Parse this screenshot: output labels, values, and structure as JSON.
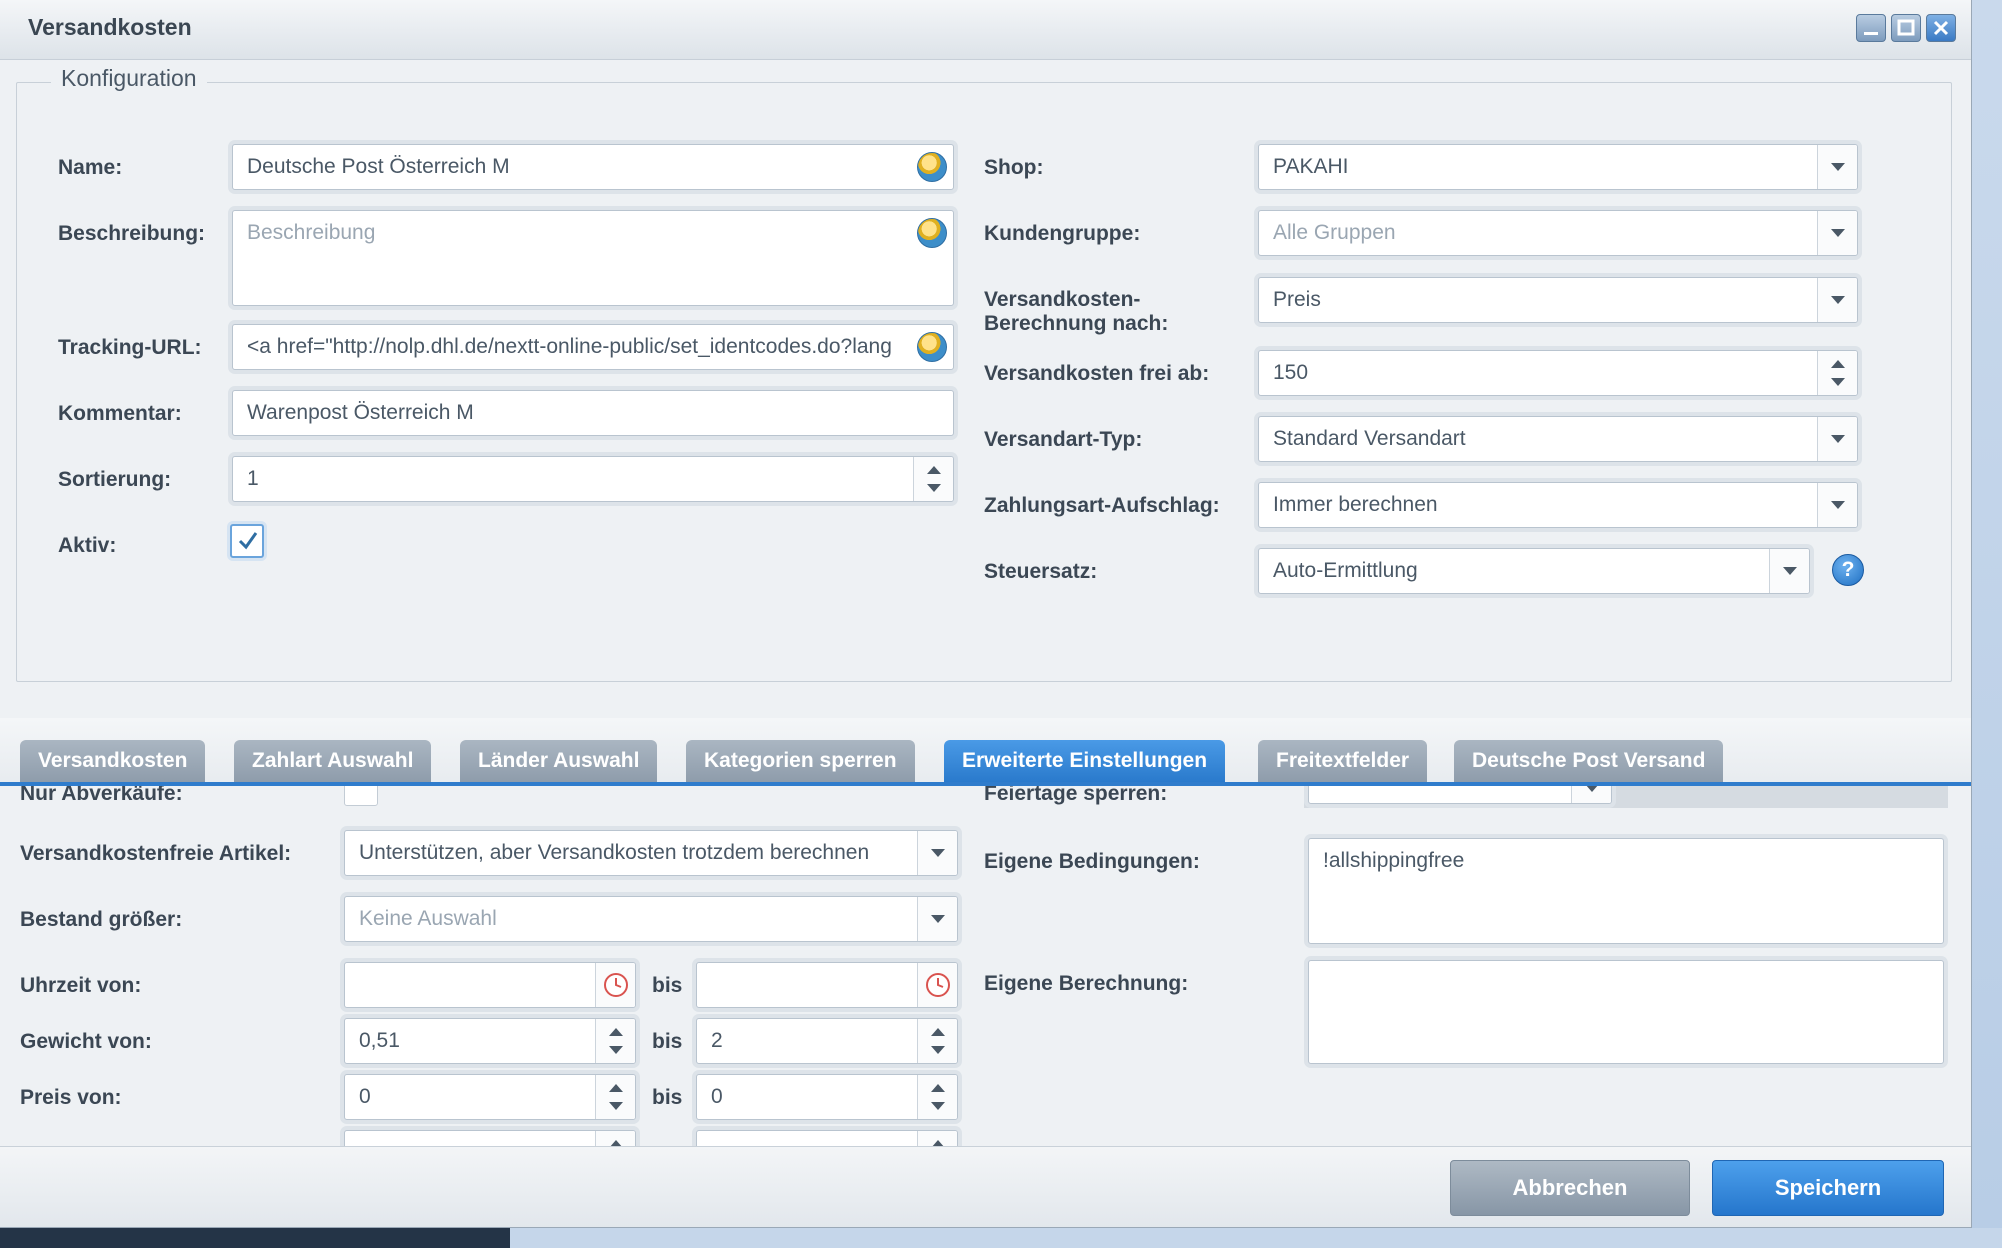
{
  "window": {
    "title": "Versandkosten"
  },
  "konfiguration": {
    "legend": "Konfiguration",
    "left": {
      "name_label": "Name:",
      "name_value": "Deutsche Post Österreich M",
      "beschreibung_label": "Beschreibung:",
      "beschreibung_placeholder": "Beschreibung",
      "tracking_label": "Tracking-URL:",
      "tracking_value": "<a href=\"http://nolp.dhl.de/nextt-online-public/set_identcodes.do?lang",
      "kommentar_label": "Kommentar:",
      "kommentar_value": "Warenpost Österreich M",
      "sortierung_label": "Sortierung:",
      "sortierung_value": "1",
      "aktiv_label": "Aktiv:",
      "aktiv_checked": true
    },
    "right": {
      "shop_label": "Shop:",
      "shop_value": "PAKAHI",
      "kundengruppe_label": "Kundengruppe:",
      "kundengruppe_value": "Alle Gruppen",
      "berechnung_label_1": "Versandkosten-",
      "berechnung_label_2": "Berechnung nach:",
      "berechnung_value": "Preis",
      "frei_ab_label": "Versandkosten frei ab:",
      "frei_ab_value": "150",
      "versandart_label": "Versandart-Typ:",
      "versandart_value": "Standard Versandart",
      "aufschlag_label": "Zahlungsart-Aufschlag:",
      "aufschlag_value": "Immer berechnen",
      "steuersatz_label": "Steuersatz:",
      "steuersatz_value": "Auto-Ermittlung",
      "help_glyph": "?"
    }
  },
  "tabs": [
    {
      "label": "Versandkosten",
      "active": false
    },
    {
      "label": "Zahlart Auswahl",
      "active": false
    },
    {
      "label": "Länder Auswahl",
      "active": false
    },
    {
      "label": "Kategorien sperren",
      "active": false
    },
    {
      "label": "Erweiterte Einstellungen",
      "active": true
    },
    {
      "label": "Freitextfelder",
      "active": false
    },
    {
      "label": "Deutsche Post Versand",
      "active": false
    }
  ],
  "erweitert": {
    "nur_abverkaeufe_label": "Nur Abverkäufe:",
    "versandkostenfreie_label": "Versandkostenfreie Artikel:",
    "versandkostenfreie_value": "Unterstützen, aber Versandkosten trotzdem berechnen",
    "bestand_label": "Bestand größer:",
    "bestand_placeholder": "Keine Auswahl",
    "uhrzeit_label": "Uhrzeit von:",
    "uhrzeit_von": "",
    "uhrzeit_bis": "",
    "gewicht_label": "Gewicht von:",
    "gewicht_von": "0,51",
    "gewicht_bis": "2",
    "preis_label": "Preis von:",
    "preis_von": "0",
    "preis_bis": "0",
    "bis_label": "bis",
    "feiertage_label": "Feiertage sperren:",
    "bedingungen_label": "Eigene Bedingungen:",
    "bedingungen_value": "!allshippingfree",
    "berechnung_label": "Eigene Berechnung:",
    "berechnung_value": ""
  },
  "buttons": {
    "cancel": "Abbrechen",
    "save": "Speichern"
  },
  "colors": {
    "accent": "#2f7ccc",
    "tab_inactive": "#9aa8b6",
    "save": "#2f84dc"
  }
}
